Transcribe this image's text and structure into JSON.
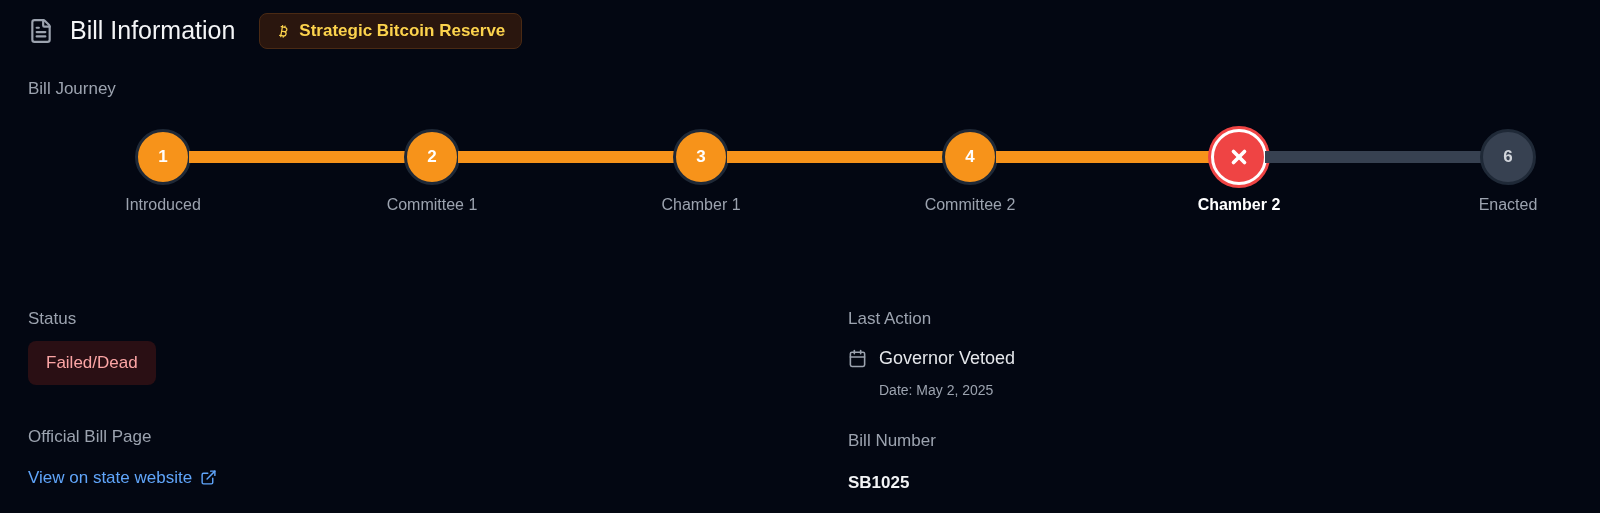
{
  "header": {
    "title": "Bill Information",
    "tag": "Strategic Bitcoin Reserve"
  },
  "journey": {
    "label": "Bill Journey",
    "steps": [
      {
        "number": "1",
        "label": "Introduced",
        "kind": "done",
        "selected": false
      },
      {
        "number": "2",
        "label": "Committee 1",
        "kind": "done",
        "selected": false
      },
      {
        "number": "3",
        "label": "Chamber 1",
        "kind": "done",
        "selected": false
      },
      {
        "number": "4",
        "label": "Committee 2",
        "kind": "done",
        "selected": false
      },
      {
        "label": "Chamber 2",
        "kind": "failed",
        "selected": true
      },
      {
        "number": "6",
        "label": "Enacted",
        "kind": "pending",
        "selected": false
      }
    ]
  },
  "status": {
    "label": "Status",
    "value": "Failed/Dead",
    "kind": "failed"
  },
  "last_action": {
    "label": "Last Action",
    "action": "Governor Vetoed",
    "date": "Date: May 2, 2025"
  },
  "official_page": {
    "label": "Official Bill Page",
    "link": "View on state website"
  },
  "bill_number": {
    "label": "Bill Number",
    "value": "SB1025"
  }
}
